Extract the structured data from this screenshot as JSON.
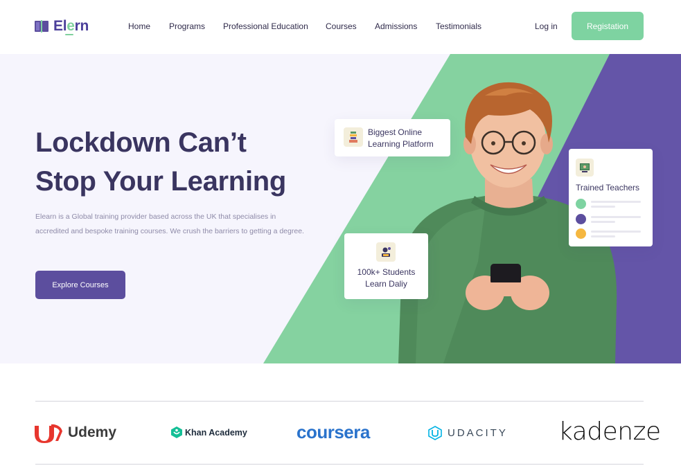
{
  "brand": {
    "name_part1": "El",
    "name_part2": "e",
    "name_part3": "rn",
    "accent": "#7ed3a1",
    "primary": "#5c4e9e"
  },
  "nav": {
    "items": [
      {
        "label": "Home"
      },
      {
        "label": "Programs"
      },
      {
        "label": "Professional Education"
      },
      {
        "label": "Courses"
      },
      {
        "label": "Admissions"
      },
      {
        "label": "Testimonials"
      }
    ],
    "login": "Log in",
    "register": "Registation"
  },
  "hero": {
    "title_line1": "Lockdown Can’t",
    "title_line2": "Stop Your Learning",
    "description": "Elearn is a Global training provider based across the UK that specialises in accredited and bespoke training courses. We crush the barriers to getting a degree.",
    "cta": "Explore Courses",
    "card_platform": {
      "line1": "Biggest Online",
      "line2": "Learning Platform",
      "icon": "book-stack-icon"
    },
    "card_students": {
      "line1": "100k+ Students",
      "line2": "Learn Daliy",
      "icon": "student-laptop-icon"
    },
    "card_teachers": {
      "title": "Trained Teachers",
      "icon": "teacher-board-icon",
      "dot_colors": [
        "#7ed3a1",
        "#5c4e9e",
        "#f5b740"
      ]
    }
  },
  "partners": [
    {
      "name": "Udemy",
      "color": "#e7362e"
    },
    {
      "name": "Khan Academy",
      "color": "#14bf96"
    },
    {
      "name": "coursera",
      "color": "#2a73cc"
    },
    {
      "name": "UDACITY",
      "color": "#02b3e4"
    },
    {
      "name": "kadenze",
      "color": "#111111"
    }
  ]
}
